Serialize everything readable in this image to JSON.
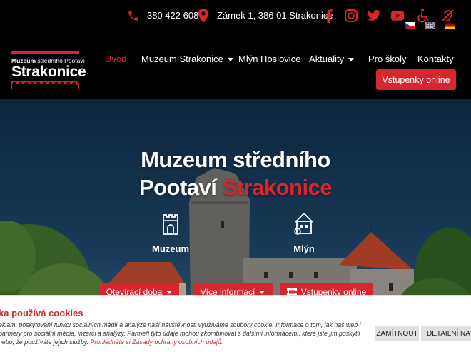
{
  "header": {
    "phone": "380 422 608",
    "address": "Zámek 1, 386 01 Strakonice",
    "social_icons": [
      "facebook-icon",
      "instagram-icon",
      "twitter-icon",
      "youtube-icon",
      "wheelchair-icon",
      "hearing-impaired-icon"
    ],
    "languages": [
      "cz",
      "en",
      "de"
    ],
    "logo": {
      "small_bold": "Muzeum",
      "small_rest": " středního Pootaví",
      "big": "Strakonice"
    },
    "nav": [
      {
        "label": "Úvod",
        "active": true
      },
      {
        "label": "Muzeum Strakonice",
        "dropdown": true
      },
      {
        "label": "Mlýn Hoslovice"
      },
      {
        "label": "Aktuality",
        "dropdown": true
      },
      {
        "label": "Pro školy"
      },
      {
        "label": "Kontakty"
      }
    ],
    "ticket_button": "Vstupenky online",
    "accent_color": "#d7262f"
  },
  "hero": {
    "title_line1": "Muzeum středního",
    "title_line2_plain": "Pootaví ",
    "title_line2_accent": "Strakonice",
    "features": [
      {
        "label": "Muzeum",
        "icon": "castle-tower-icon"
      },
      {
        "label": "Mlýn",
        "icon": "mill-building-icon"
      }
    ],
    "buttons": [
      {
        "label": "Otevírací doba"
      },
      {
        "label": "Více informací"
      },
      {
        "label": "Vstupenky online",
        "icon": "ticket-icon"
      }
    ]
  },
  "cookie": {
    "title": "ka používá cookies",
    "text_main": "eklam, poskytování funkcí sociálních médií a analýze naší návštěvnosti využíváme soubory cookie. Informace o tom, jak náš web i partnery pro sociální média, inzerci a analýzy. Partneři tyto údaje mohou zkombinovat s dalšími informacemi, které jste jim poskytli nebo, že používáte jejich služby. ",
    "link": "Prohlédněte si Zásady ochrany osobních údajů.",
    "decline_button": "ZAMÍTNOUT",
    "details_button": "DETAILNÍ NASTAV"
  }
}
